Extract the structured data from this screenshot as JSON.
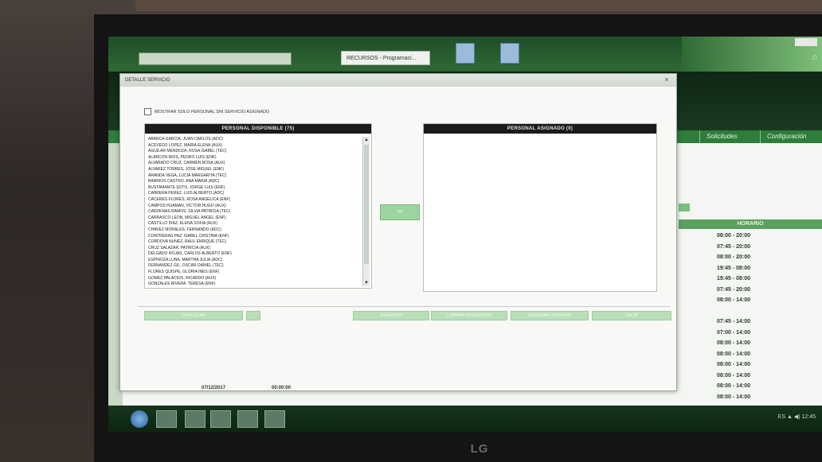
{
  "browser": {
    "tab_label": "RECURSOS - Programaci...",
    "url": "http://..."
  },
  "nav": {
    "items": [
      "Solicitudes",
      "Configuración"
    ]
  },
  "dialog": {
    "title": "DETALLE SERVICIO",
    "close_label": "×",
    "checkbox_label": "MOSTRAR SOLO PERSONAL SIN SERVICIO ASIGNADO",
    "left_panel_header": "PERSONAL DISPONIBLE (75)",
    "right_panel_header": "PERSONAL ASIGNADO (0)",
    "move_button_label": ">>",
    "available_staff": [
      "ABARCA GARCIA, JUAN CARLOS (ADC)",
      "ACEVEDO LOPEZ, MARIA ELENA (AUX)",
      "AGUILAR MENDOZA, ROSA ISABEL (TEC)",
      "ALARCON RIOS, PEDRO LUIS (ENF)",
      "ALVARADO CRUZ, CARMEN ROSA (AUX)",
      "ALVAREZ TORRES, JOSE MIGUEL (ENF)",
      "ARANDA VEGA, LUCIA MARGARITA (TEC)",
      "BARRIOS CASTRO, ANA MARIA (ADC)",
      "BUSTAMANTE SOTO, JORGE LUIS (ENF)",
      "CABRERA PEREZ, LUIS ALBERTO (ADC)",
      "CACERES FLORES, ROSA ANGELICA (ENF)",
      "CAMPOS HUAMAN, VICTOR HUGO (AUX)",
      "CARDENAS RAMOS, SILVIA PATRICIA (TEC)",
      "CARRASCO LEON, MIGUEL ANGEL (ENF)",
      "CASTILLO DIAZ, ELENA SOFIA (AUX)",
      "CHAVEZ MORALES, FERNANDO (ADC)",
      "CONTRERAS PAZ, ISABEL CRISTINA (ENF)",
      "CORDOVA NUÑEZ, RAUL ENRIQUE (TEC)",
      "CRUZ SALAZAR, PATRICIA (AUX)",
      "DELGADO ROJAS, CARLOS ALBERTO (ENF)",
      "ESPINOZA LUNA, MARTHA JULIA (ADC)",
      "FERNANDEZ GIL, OSCAR DANIEL (TEC)",
      "FLORES QUISPE, GLORIA INES (ENF)",
      "GOMEZ PALACIOS, RICARDO (AUX)",
      "GONZALES RIVERA, TERESA (ENF)"
    ],
    "buttons": [
      "CANCELAR",
      "GUARDAR",
      "LIMPIAR ASIGNADOS",
      "GENERAR HORARIO",
      "SALIR"
    ],
    "footer_texts": [
      "07/12/2017",
      "00:00:00"
    ]
  },
  "schedule": {
    "header": "HORARIO",
    "rows": [
      "08:00 - 20:00",
      "07:45 - 20:00",
      "08:00 - 20:00",
      "19:45 - 08:00",
      "19:45 - 08:00",
      "07:45 - 20:00",
      "08:00 - 14:00",
      "",
      "07:45 - 14:00",
      "07:00 - 14:00",
      "08:00 - 14:00",
      "08:00 - 14:00",
      "08:00 - 14:00",
      "08:00 - 14:00",
      "08:00 - 14:00",
      "08:00 - 14:00"
    ]
  },
  "taskbar": {
    "tray_text": "ES  ▲  ◀)  12:45"
  },
  "monitor": {
    "brand": "LG"
  },
  "colors": {
    "accent_green": "#2e7d3a",
    "button_green": "#9bd49c",
    "panel_header": "#1b1b1b"
  }
}
